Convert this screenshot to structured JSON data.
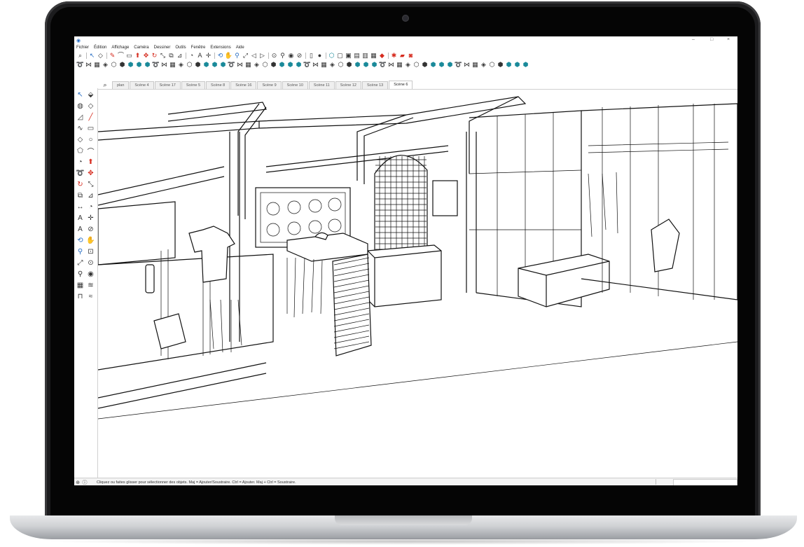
{
  "app": {
    "window_controls": [
      "–",
      "□",
      "×"
    ]
  },
  "menu": [
    "Fichier",
    "Édition",
    "Affichage",
    "Caméra",
    "Dessiner",
    "Outils",
    "Fenêtre",
    "Extensions",
    "Aide"
  ],
  "tabs": {
    "items": [
      "plan",
      "Scène 4",
      "Scène 17",
      "Scène 5",
      "Scène 8",
      "Scène 16",
      "Scène 9",
      "Scène 10",
      "Scène 11",
      "Scène 12",
      "Scène 13",
      "Scène 6"
    ],
    "active": "Scène 6"
  },
  "status": {
    "message": "Cliquez ou faites glisser pour sélectionner des objets. Maj = Ajouter/Soustraire. Ctrl = Ajouter. Maj + Ctrl = Soustraire."
  },
  "colors": {
    "accent_red": "#d62b1e",
    "accent_blue": "#2a6fc4",
    "teal": "#1a8a9a"
  },
  "icons": {
    "row1": [
      "search-icon",
      "select-icon",
      "eraser-icon",
      "pencil-icon",
      "arc-icon",
      "rectangle-icon",
      "push-pull-icon",
      "move-icon",
      "rotate-icon",
      "scale-icon",
      "offset-icon",
      "tape-measure-icon",
      "protractor-icon",
      "text-icon",
      "axes-icon",
      "orbit-icon",
      "pan-icon",
      "zoom-icon",
      "zoom-extents-icon",
      "previous-icon",
      "next-icon",
      "position-camera-icon",
      "walk-icon",
      "look-around-icon",
      "section-icon",
      "new-icon",
      "user-icon",
      "iso-icon",
      "top-icon",
      "front-icon",
      "right-icon",
      "back-icon",
      "left-icon",
      "ruby-icon",
      "gear-icon",
      "folder-icon",
      "camera-icon"
    ],
    "row2": [
      "follow-me-icon",
      "intersect-icon",
      "sandbox-icon",
      "xray-icon",
      "wireframe-icon",
      "hidden-line-icon",
      "shaded-icon",
      "textured-icon",
      "monochrome-icon"
    ],
    "left": [
      "select-icon",
      "component-icon",
      "paint-icon",
      "eraser-icon",
      "tag-icon",
      "line-icon",
      "freehand-icon",
      "rectangle-icon",
      "rotated-rect-icon",
      "circle-icon",
      "polygon-icon",
      "arc-icon",
      "pie-icon",
      "push-pull-icon",
      "follow-me-icon",
      "move-icon",
      "rotate-icon",
      "scale-icon",
      "offset-icon",
      "tape-icon",
      "dimension-icon",
      "protractor-icon",
      "text-icon",
      "axes-icon",
      "3d-text-icon",
      "section-icon",
      "orbit-icon",
      "pan-icon",
      "zoom-icon",
      "zoom-window-icon",
      "zoom-extents-icon",
      "position-camera-icon",
      "walk-icon",
      "look-around-icon",
      "sandbox-icon",
      "smoove-icon",
      "stamp-icon",
      "drape-icon"
    ]
  }
}
